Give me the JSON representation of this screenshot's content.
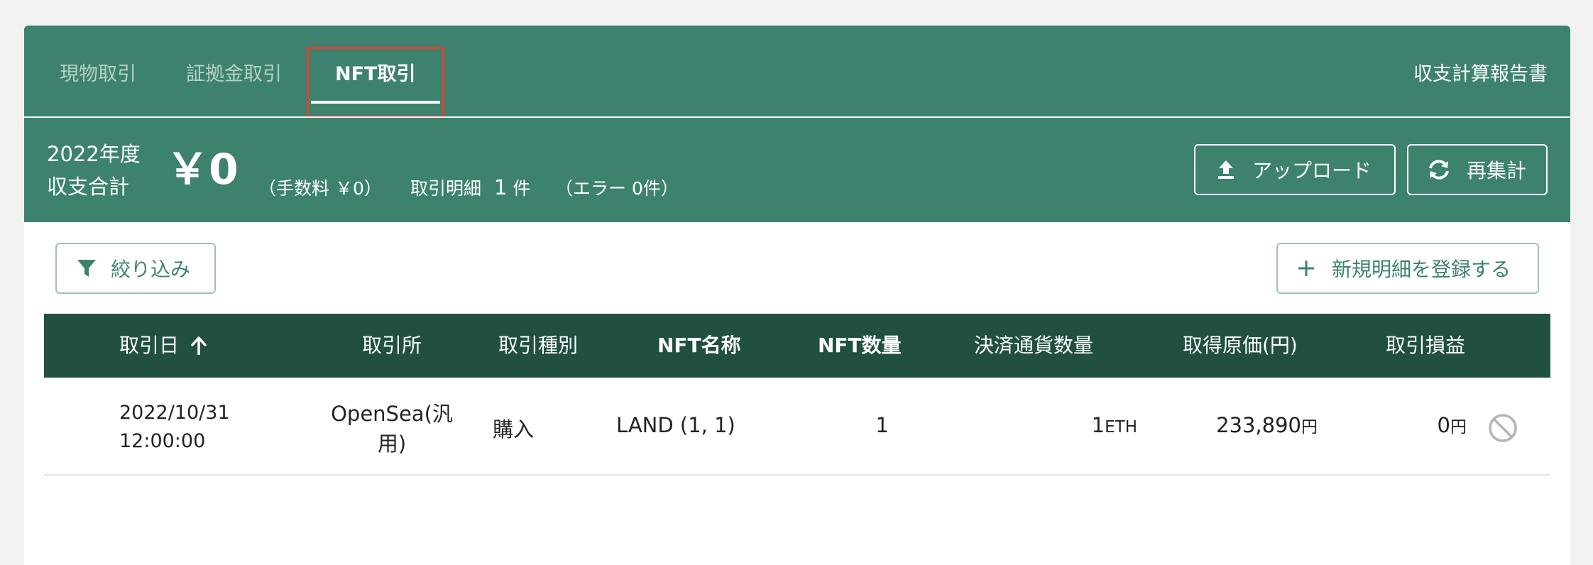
{
  "tabs": [
    {
      "label": "現物取引",
      "active": false
    },
    {
      "label": "証拠金取引",
      "active": false
    },
    {
      "label": "NFT取引",
      "active": true
    }
  ],
  "report_link": "収支計算報告書",
  "summary": {
    "year_label": "2022年度",
    "total_label": "収支合計",
    "total_value": "￥0",
    "fee_text": "（手数料 ￥0）",
    "count_label": "取引明細",
    "count_value": "1",
    "count_unit": "件",
    "error_text": "（エラー 0件）"
  },
  "buttons": {
    "upload": "アップロード",
    "reaggregate": "再集計",
    "filter": "絞り込み",
    "add_entry": "新規明細を登録する"
  },
  "table": {
    "columns": [
      "取引日",
      "取引所",
      "取引種別",
      "NFT名称",
      "NFT数量",
      "決済通貨数量",
      "取得原価(円)",
      "取引損益"
    ],
    "sort_column": "取引日",
    "sort_direction": "ascending",
    "rows": [
      {
        "date": "2022/10/31",
        "time": "12:00:00",
        "exchange_line1": "OpenSea(汎",
        "exchange_line2": "用)",
        "type": "購入",
        "nft_name": "LAND (1, 1)",
        "nft_qty": "1",
        "settle_qty": "1",
        "settle_unit": "ETH",
        "cost": "233,890",
        "cost_unit": "円",
        "pnl": "0",
        "pnl_unit": "円",
        "action_icon": "disabled-circle-icon"
      }
    ]
  },
  "colors": {
    "header_bg": "#3d826f",
    "table_header_bg": "#21503f",
    "highlight_border": "#e2402f",
    "page_bg": "#f2f2f2"
  },
  "icons": {
    "upload": "upload-icon",
    "reaggregate": "refresh-icon",
    "filter": "filter-icon",
    "add": "plus-icon",
    "sort": "arrow-up-icon"
  }
}
